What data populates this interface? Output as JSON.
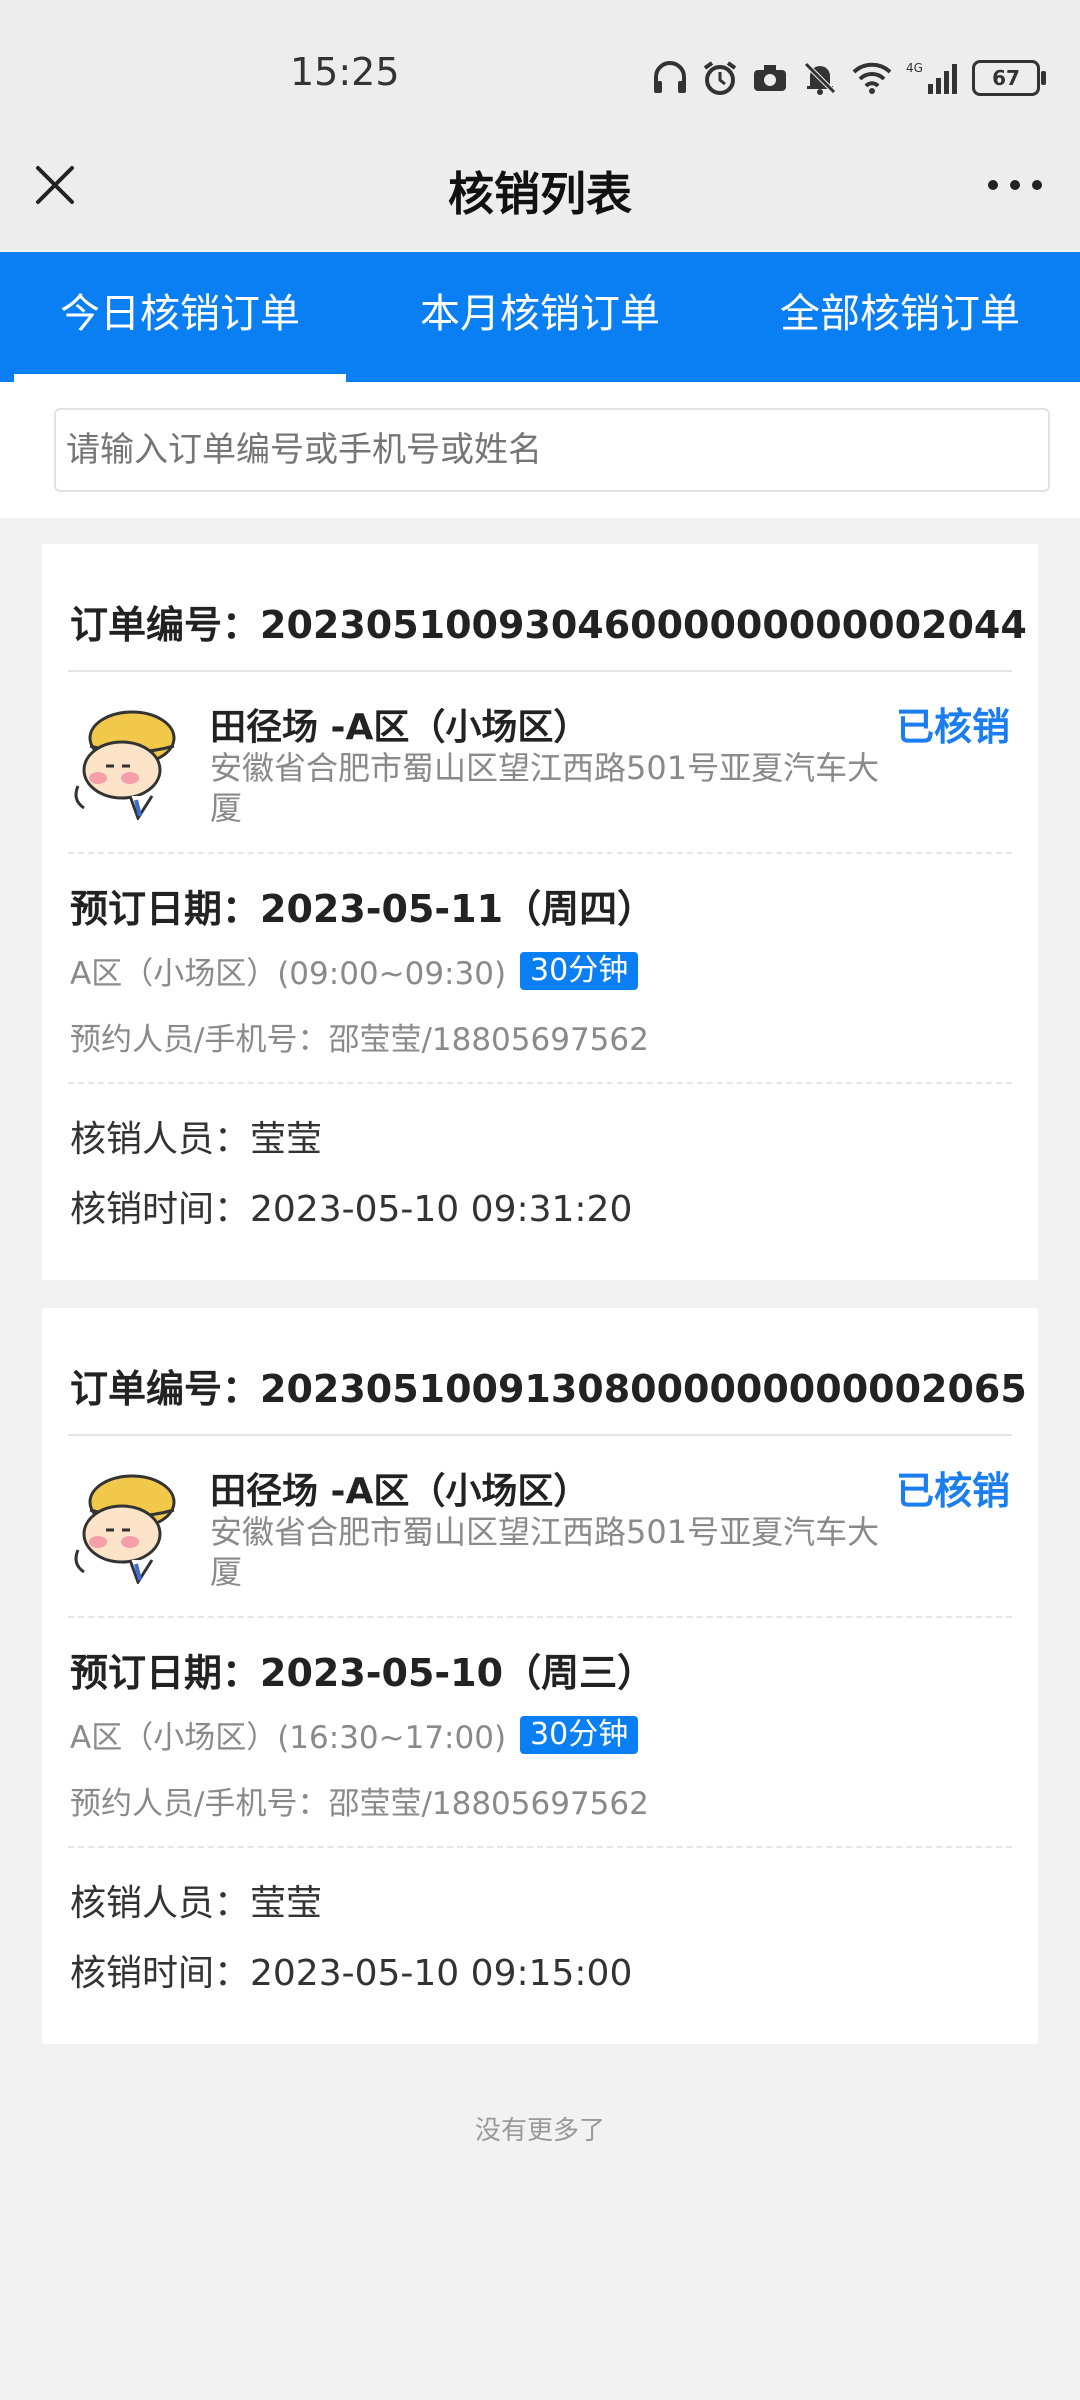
{
  "status_bar": {
    "time": "15:25",
    "battery": "67",
    "network": "4G"
  },
  "nav": {
    "title": "核销列表"
  },
  "tabs": [
    {
      "label": "今日核销订单",
      "active": true
    },
    {
      "label": "本月核销订单",
      "active": false
    },
    {
      "label": "全部核销订单",
      "active": false
    }
  ],
  "search": {
    "placeholder": "请输入订单编号或手机号或姓名"
  },
  "orders": [
    {
      "order_label": "订单编号：20230510093046000000000002044",
      "venue": "田径场 -A区（小场区）",
      "address": "安徽省合肥市蜀山区望江西路501号亚夏汽车大厦",
      "status": "已核销",
      "booking_date": "预订日期：2023-05-11（周四）",
      "slot": "A区（小场区）(09:00~09:30)",
      "duration": "30分钟",
      "reserver": "预约人员/手机号：邵莹莹/18805697562",
      "verifier": "核销人员：莹莹",
      "verify_time": "核销时间：2023-05-10 09:31:20"
    },
    {
      "order_label": "订单编号：20230510091308000000000002065",
      "venue": "田径场 -A区（小场区）",
      "address": "安徽省合肥市蜀山区望江西路501号亚夏汽车大厦",
      "status": "已核销",
      "booking_date": "预订日期：2023-05-10（周三）",
      "slot": "A区（小场区）(16:30~17:00)",
      "duration": "30分钟",
      "reserver": "预约人员/手机号：邵莹莹/18805697562",
      "verifier": "核销人员：莹莹",
      "verify_time": "核销时间：2023-05-10 09:15:00"
    }
  ],
  "footer": {
    "no_more": "没有更多了"
  },
  "colors": {
    "accent": "#0a7ff3",
    "status_text": "#1a7ef0"
  }
}
